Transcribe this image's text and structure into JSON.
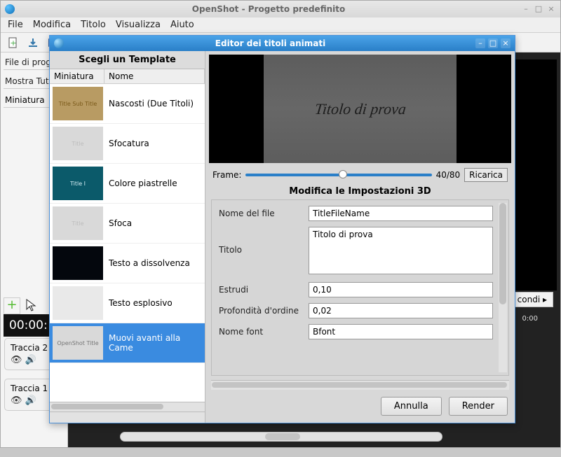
{
  "main": {
    "title": "OpenShot - Progetto predefinito",
    "menu": {
      "file": "File",
      "edit": "Modifica",
      "titolo": "Titolo",
      "visualizza": "Visualizza",
      "aiuto": "Aiuto"
    },
    "left": {
      "head1": "File di proge",
      "head2": "Mostra Tutt",
      "col": "Miniatura"
    },
    "timecode": "00:00:",
    "secondsBtn": "condi",
    "rulerZero": "0:00",
    "tracks": {
      "t2": "Traccia 2",
      "t1": "Traccia 1"
    }
  },
  "dialog": {
    "title": "Editor dei titoli animati",
    "tplHead": "Scegli un Template",
    "cols": {
      "thumb": "Miniatura",
      "name": "Nome"
    },
    "templates": [
      {
        "thumbText": "Title\nSub Title",
        "label": "Nascosti (Due Titoli)",
        "bg": "#b89b63",
        "fg": "#7a5a1a"
      },
      {
        "thumbText": "Title",
        "label": "Sfocatura",
        "bg": "#d9d9d9",
        "fg": "#bdbdbd"
      },
      {
        "thumbText": "Title I",
        "label": "Colore piastrelle",
        "bg": "#0b5a6a",
        "fg": "#d5eef4"
      },
      {
        "thumbText": "Title",
        "label": "Sfoca",
        "bg": "#d9d9d9",
        "fg": "#bdbdbd"
      },
      {
        "thumbText": "",
        "label": "Testo a dissolvenza",
        "bg": "#04070d",
        "fg": "#2a5aa8"
      },
      {
        "thumbText": "",
        "label": "Testo esplosivo",
        "bg": "#e9e9e9",
        "fg": "#3b4a3a"
      },
      {
        "thumbText": "OpenShot Title",
        "label": "Muovi avanti alla Came",
        "bg": "#d9d9d9",
        "fg": "#757575"
      }
    ],
    "selectedIndex": 6,
    "previewText": "Titolo di prova",
    "frameLabel": "Frame:",
    "frameValue": "40/80",
    "reload": "Ricarica",
    "settingsHead": "Modifica le Impostazioni 3D",
    "fields": {
      "filenameLabel": "Nome del file",
      "filename": "TitleFileName",
      "titleLabel": "Titolo",
      "title": "Titolo di prova",
      "extrudeLabel": "Estrudi",
      "extrude": "0,10",
      "depthLabel": "Profondità d'ordine",
      "depth": "0,02",
      "fontLabel": "Nome font",
      "font": "Bfont"
    },
    "buttons": {
      "cancel": "Annulla",
      "render": "Render"
    }
  }
}
